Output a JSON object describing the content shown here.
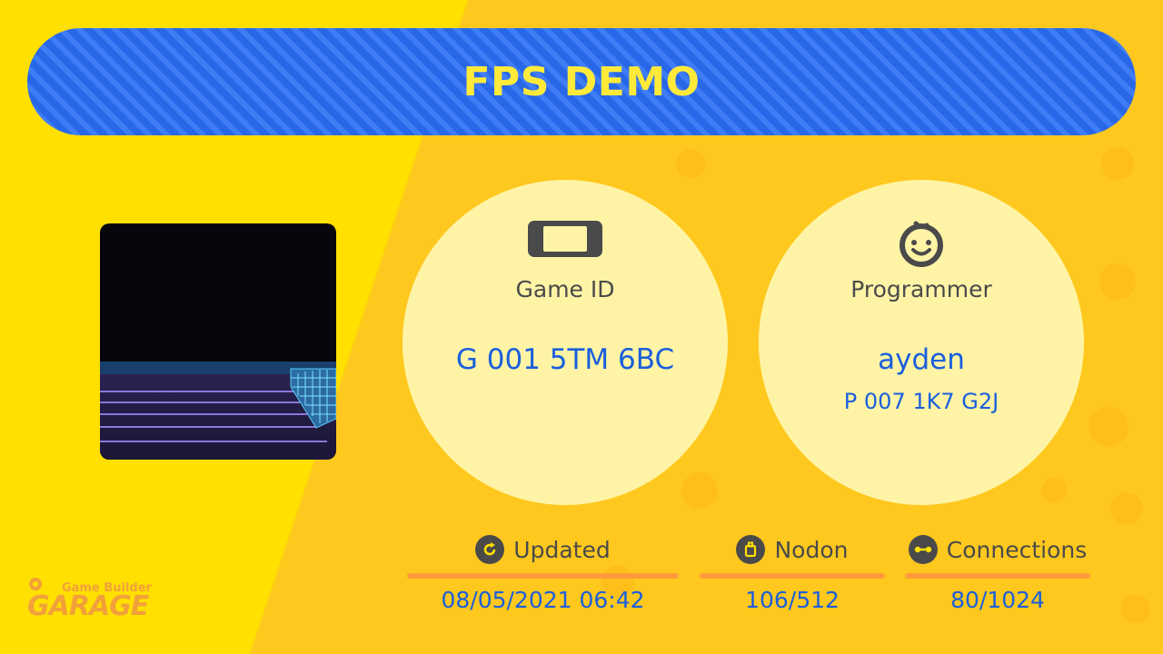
{
  "title": "FPS DEMO",
  "game_id": {
    "icon": "console-icon",
    "label": "Game ID",
    "value": "G 001 5TM 6BC"
  },
  "programmer": {
    "icon": "smiley-face-icon",
    "label": "Programmer",
    "name": "ayden",
    "id": "P 007 1K7 G2J"
  },
  "stats": {
    "updated": {
      "icon": "refresh-icon",
      "label": "Updated",
      "value": "08/05/2021 06:42"
    },
    "nodon": {
      "icon": "nodon-icon",
      "label": "Nodon",
      "value": "106/512"
    },
    "connections": {
      "icon": "connection-icon",
      "label": "Connections",
      "value": "80/1024"
    }
  },
  "logo": {
    "top": "Game Builder",
    "main": "GARAGE"
  },
  "colors": {
    "background": "#ffe000",
    "background_diagonal": "#ffc81e",
    "title_bar": "#2767e8",
    "title_text": "#ffea3a",
    "circle": "#fff4a6",
    "value_text": "#1a5fdc",
    "rule": "#ff9a3c"
  }
}
